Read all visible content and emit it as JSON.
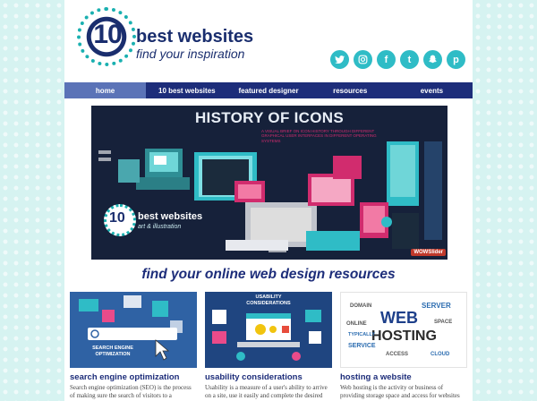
{
  "logo": {
    "number": "10",
    "title": "best websites",
    "tagline": "find your inspiration"
  },
  "social": [
    {
      "name": "twitter",
      "glyph": ""
    },
    {
      "name": "instagram",
      "glyph": ""
    },
    {
      "name": "facebook",
      "glyph": "f"
    },
    {
      "name": "tumblr",
      "glyph": "t"
    },
    {
      "name": "snapchat",
      "glyph": ""
    },
    {
      "name": "pinterest",
      "glyph": "p"
    }
  ],
  "nav": [
    {
      "label": "home",
      "active": true
    },
    {
      "label": "10 best websites",
      "active": false
    },
    {
      "label": "featured designer",
      "active": false
    },
    {
      "label": "resources",
      "active": false
    },
    {
      "label": "events",
      "active": false
    }
  ],
  "hero": {
    "title": "HISTORY OF ICONS",
    "subtitle": "A VISUAL BRIEF ON ICON HISTORY THROUGH DIFFERENT GRAPHICAL USER INTERFACES IN DIFFERENT OPERATING SYSTEMS",
    "logo_number": "10",
    "logo_title": "best websites",
    "logo_tagline": "art & illustration",
    "badge": "WOWSlider"
  },
  "section_title": "find your online web design resources",
  "cards": [
    {
      "title": "search engine optimization",
      "text": "Search engine optimization (SEO) is the process of making sure the search of visitors to a",
      "image_label": "SEARCH ENGINE OPTIMIZATION"
    },
    {
      "title": "usability considerations",
      "text": "Usability is a measure of a user's ability to arrive on a site, use it easily and complete the desired",
      "image_label": "USABILITY CONSIDERATIONS"
    },
    {
      "title": "hosting a website",
      "text": "Web hosting is the activity or business of providing storage space and access for websites",
      "image_words": [
        "WEB",
        "HOSTING",
        "SERVER",
        "SERVICE",
        "DOMAIN",
        "SPACE",
        "CLOUD",
        "ACCESS",
        "ONLINE",
        "TYPICALLY"
      ]
    }
  ],
  "colors": {
    "brand_navy": "#1d2d7a",
    "nav_active": "#5b73b7",
    "accent_teal": "#2fbcc6",
    "background": "#d6f3f1"
  }
}
